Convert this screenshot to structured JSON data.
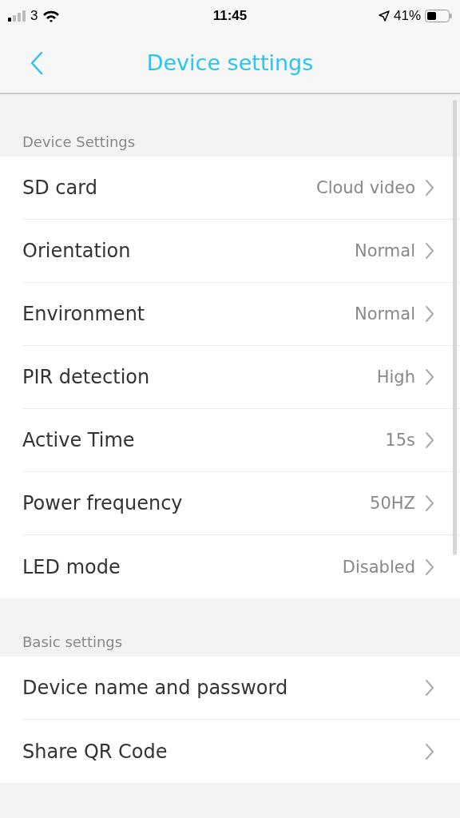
{
  "status_bar": {
    "carrier": "3",
    "time": "11:45",
    "battery": "41%"
  },
  "nav": {
    "title": "Device settings"
  },
  "sections": [
    {
      "title": "Device Settings",
      "rows": [
        {
          "label": "SD card",
          "value": "Cloud video"
        },
        {
          "label": "Orientation",
          "value": "Normal"
        },
        {
          "label": "Environment",
          "value": "Normal"
        },
        {
          "label": "PIR detection",
          "value": "High"
        },
        {
          "label": "Active Time",
          "value": "15s"
        },
        {
          "label": "Power frequency",
          "value": "50HZ"
        },
        {
          "label": "LED mode",
          "value": "Disabled"
        }
      ]
    },
    {
      "title": "Basic settings",
      "rows": [
        {
          "label": "Device name and password"
        },
        {
          "label": "Share QR Code"
        }
      ]
    }
  ]
}
